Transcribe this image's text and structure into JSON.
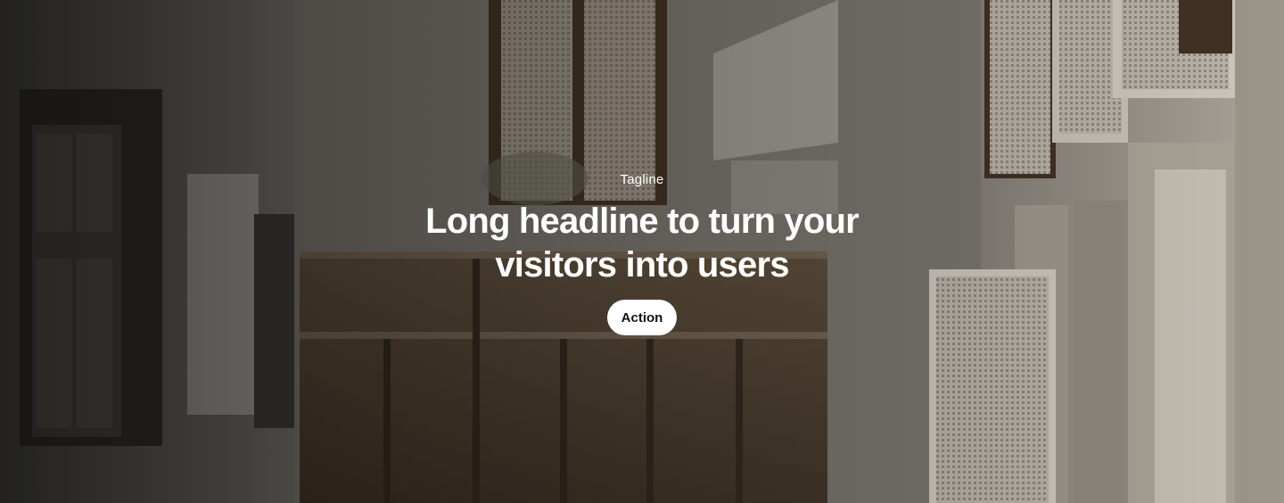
{
  "hero": {
    "tagline": "Tagline",
    "headline": "Long headline to turn your visitors into users",
    "action_label": "Action",
    "background_image": "architectural-interior-photo"
  },
  "colors": {
    "text": "#ffffff",
    "button_bg": "#ffffff",
    "button_text": "#111111"
  }
}
